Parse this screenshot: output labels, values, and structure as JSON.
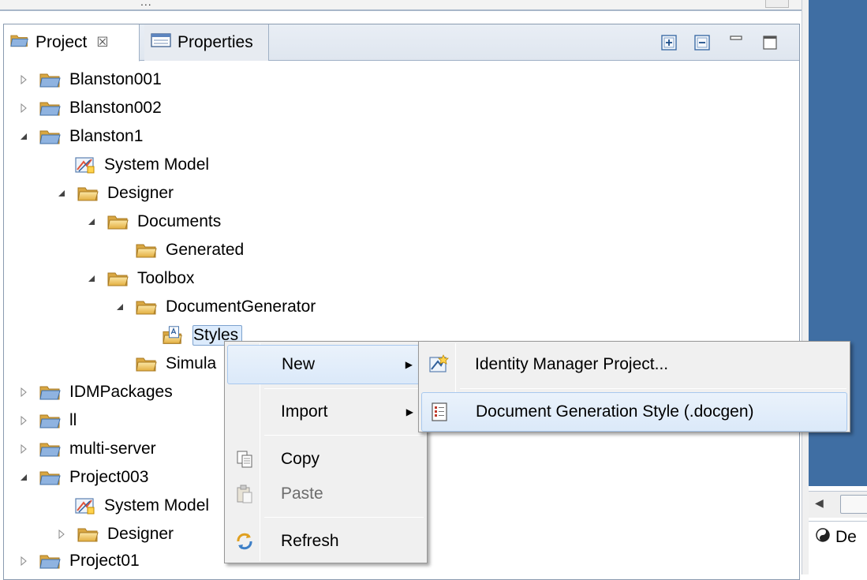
{
  "top_strip": {
    "dots": "..."
  },
  "tabs": {
    "project": {
      "label": "Project",
      "close": "☒"
    },
    "properties": {
      "label": "Properties"
    }
  },
  "tree": {
    "blanston001": "Blanston001",
    "blanston002": "Blanston002",
    "blanston1": "Blanston1",
    "system_model": "System Model",
    "designer": "Designer",
    "documents": "Documents",
    "generated": "Generated",
    "toolbox": "Toolbox",
    "document_generator": "DocumentGenerator",
    "styles": "Styles",
    "simula": "Simula",
    "idm_packages": "IDMPackages",
    "ll": "ll",
    "multi_server": "multi-server",
    "project003": "Project003",
    "system_model_2": "System Model",
    "designer_2": "Designer",
    "project01": "Project01"
  },
  "context_menu": {
    "new": "New",
    "import": "Import",
    "copy": "Copy",
    "paste": "Paste",
    "refresh": "Refresh"
  },
  "submenu": {
    "identity_manager_project": "Identity Manager Project...",
    "document_generation_style": "Document Generation Style (.docgen)"
  },
  "right_panel": {
    "bottom_tab": "De"
  },
  "colors": {
    "accent_blue": "#3f6ea3",
    "menu_highlight": "#dbe9f9",
    "folder": "#e9b84a"
  }
}
